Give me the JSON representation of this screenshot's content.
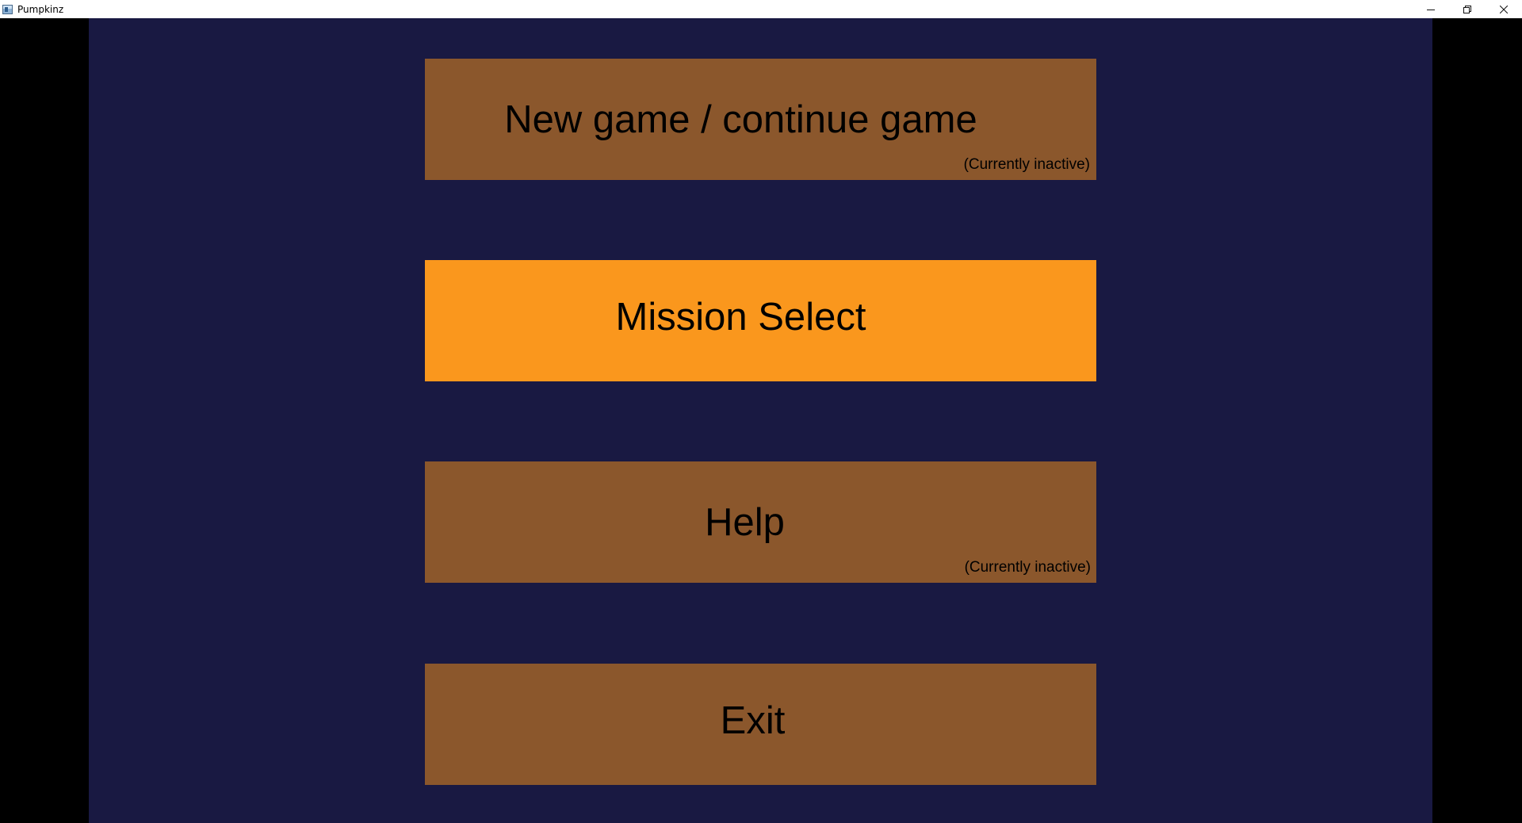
{
  "window": {
    "title": "Pumpkinz",
    "controls": {
      "minimize_icon": "minimize-icon",
      "restore_icon": "restore-icon",
      "close_icon": "close-icon"
    }
  },
  "colors": {
    "background": "#191942",
    "button": "#8b572c",
    "button_selected": "#fa971d",
    "letterbox": "#000000"
  },
  "menu": {
    "items": [
      {
        "label": "New game / continue game",
        "note": "(Currently inactive)",
        "selected": false
      },
      {
        "label": "Mission Select",
        "note": "",
        "selected": true
      },
      {
        "label": "Help",
        "note": "(Currently inactive)",
        "selected": false
      },
      {
        "label": "Exit",
        "note": "",
        "selected": false
      }
    ]
  }
}
